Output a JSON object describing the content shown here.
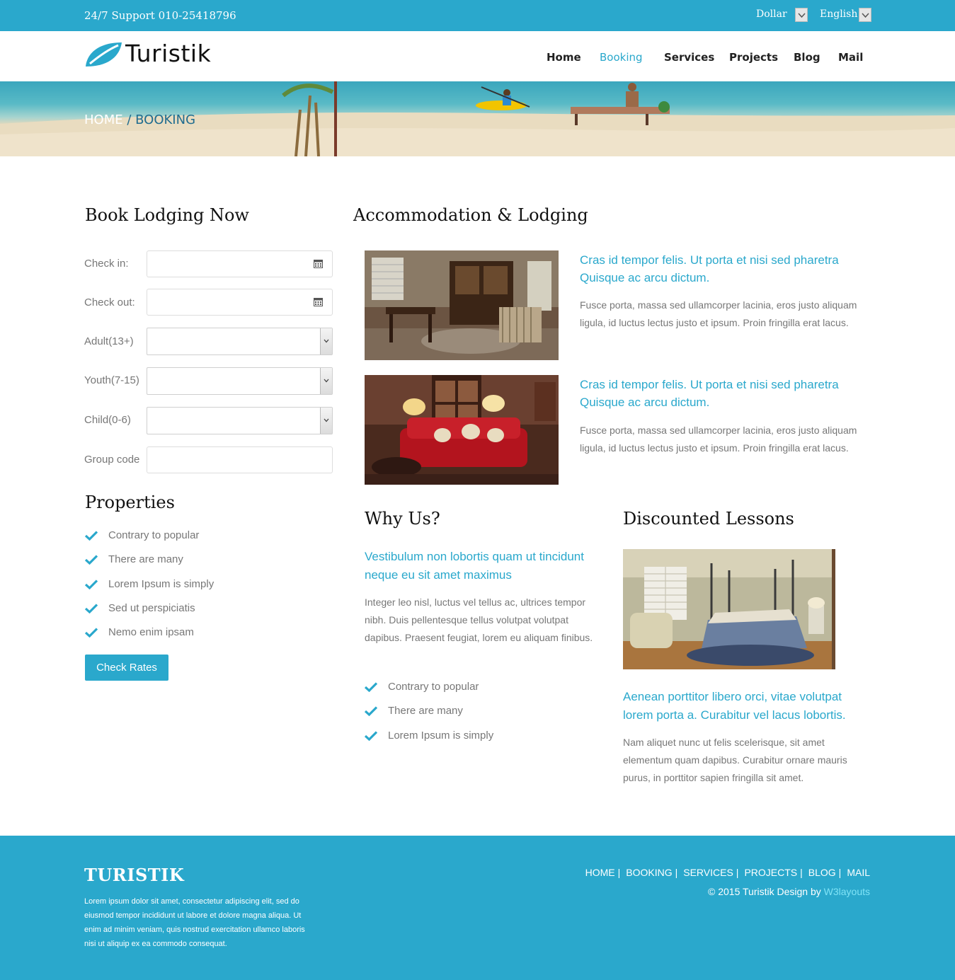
{
  "topbar": {
    "support": "24/7 Support 010-25418796",
    "currency": "Dollar",
    "language": "English"
  },
  "header": {
    "logo": "Turistik",
    "nav": [
      "Home",
      "Booking",
      "Services",
      "Projects",
      "Blog",
      "Mail"
    ],
    "active_nav": "Booking"
  },
  "breadcrumb": {
    "home": "HOME",
    "separator": " / ",
    "current": "BOOKING"
  },
  "booking": {
    "title": "Book Lodging Now",
    "fields": [
      {
        "label": "Check in:",
        "type": "date",
        "value": ""
      },
      {
        "label": "Check out:",
        "type": "date",
        "value": ""
      },
      {
        "label": "Adult(13+)",
        "type": "select",
        "value": ""
      },
      {
        "label": "Youth(7-15)",
        "type": "select",
        "value": ""
      },
      {
        "label": "Child(0-6)",
        "type": "select",
        "value": ""
      },
      {
        "label": "Group code",
        "type": "text",
        "value": ""
      }
    ]
  },
  "properties": {
    "title": "Properties",
    "items": [
      "Contrary to popular",
      "There are many",
      "Lorem Ipsum is simply",
      "Sed ut perspiciatis",
      "Nemo enim ipsam"
    ],
    "button": "Check Rates"
  },
  "accommodation": {
    "title": "Accommodation & Lodging",
    "cards": [
      {
        "title": "Cras id tempor felis. Ut porta et nisi sed pharetra Quisque ac arcu dictum.",
        "text": "Fusce porta, massa sed ullamcorper lacinia, eros justo aliquam ligula, id luctus lectus justo et ipsum. Proin fringilla erat lacus."
      },
      {
        "title": "Cras id tempor felis. Ut porta et nisi sed pharetra Quisque ac arcu dictum.",
        "text": "Fusce porta, massa sed ullamcorper lacinia, eros justo aliquam ligula, id luctus lectus justo et ipsum. Proin fringilla erat lacus."
      }
    ]
  },
  "why_us": {
    "title": "Why Us?",
    "subtitle": "Vestibulum non lobortis quam ut tincidunt neque eu sit amet maximus",
    "text": "Integer leo nisl, luctus vel tellus ac, ultrices tempor nibh. Duis pellentesque tellus volutpat volutpat dapibus. Praesent feugiat, lorem eu aliquam finibus.",
    "items": [
      "Contrary to popular",
      "There are many",
      "Lorem Ipsum is simply"
    ]
  },
  "lessons": {
    "title": "Discounted Lessons",
    "subtitle": "Aenean porttitor libero orci, vitae volutpat lorem porta a. Curabitur vel lacus lobortis.",
    "text": "Nam aliquet nunc ut felis scelerisque, sit amet elementum quam dapibus. Curabitur ornare mauris purus, in porttitor sapien fringilla sit amet."
  },
  "footer": {
    "brand": "TURISTIK",
    "text": "Lorem ipsum dolor sit amet, consectetur adipiscing elit, sed do eiusmod tempor incididunt ut labore et dolore magna aliqua. Ut enim ad minim veniam, quis nostrud exercitation ullamco laboris nisi ut aliquip ex ea commodo consequat.",
    "links": [
      "HOME",
      "BOOKING",
      "SERVICES",
      "PROJECTS",
      "BLOG",
      "MAIL"
    ],
    "copyright": "© 2015 Turistik Design by ",
    "credit": "W3layouts"
  },
  "colors": {
    "accent": "#2aa8cc",
    "heading": "#111111",
    "text": "#777777"
  }
}
